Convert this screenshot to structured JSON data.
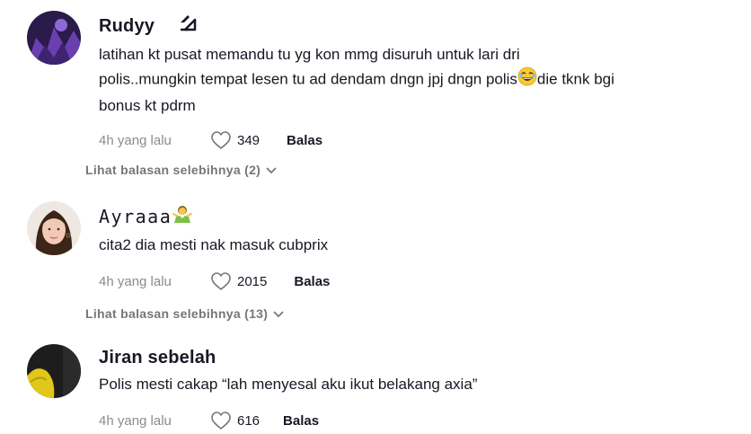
{
  "comments": [
    {
      "username": "Rudyy",
      "text_lines": [
        "latihan kt pusat memandu tu yg kon mmg disuruh untuk lari dri",
        "polis..mungkin tempat lesen tu ad dendam dngn jpj dngn polis",
        "die tknk bgi",
        "bonus kt pdrm"
      ],
      "time": "4h yang lalu",
      "likes": "349",
      "reply_label": "Balas",
      "more_replies": "Lihat balasan selebihnya (2)"
    },
    {
      "username": "Ayraaa",
      "text_lines": [
        "cita2 dia mesti nak masuk cubprix"
      ],
      "time": "4h yang lalu",
      "likes": "2015",
      "reply_label": "Balas",
      "more_replies": "Lihat balasan selebihnya (13)"
    },
    {
      "username": "Jiran sebelah",
      "text_lines": [
        "Polis mesti cakap “lah menyesal aku ikut belakang axia”"
      ],
      "time": "4h yang lalu",
      "likes": "616",
      "reply_label": "Balas"
    }
  ],
  "colors": {
    "text": "#161823",
    "meta": "#8a8b91",
    "more": "#75767c"
  },
  "icons": [
    "heart-outline-icon",
    "chevron-down-icon",
    "badge-icon",
    "laughing-emoji",
    "shrug-emoji"
  ]
}
